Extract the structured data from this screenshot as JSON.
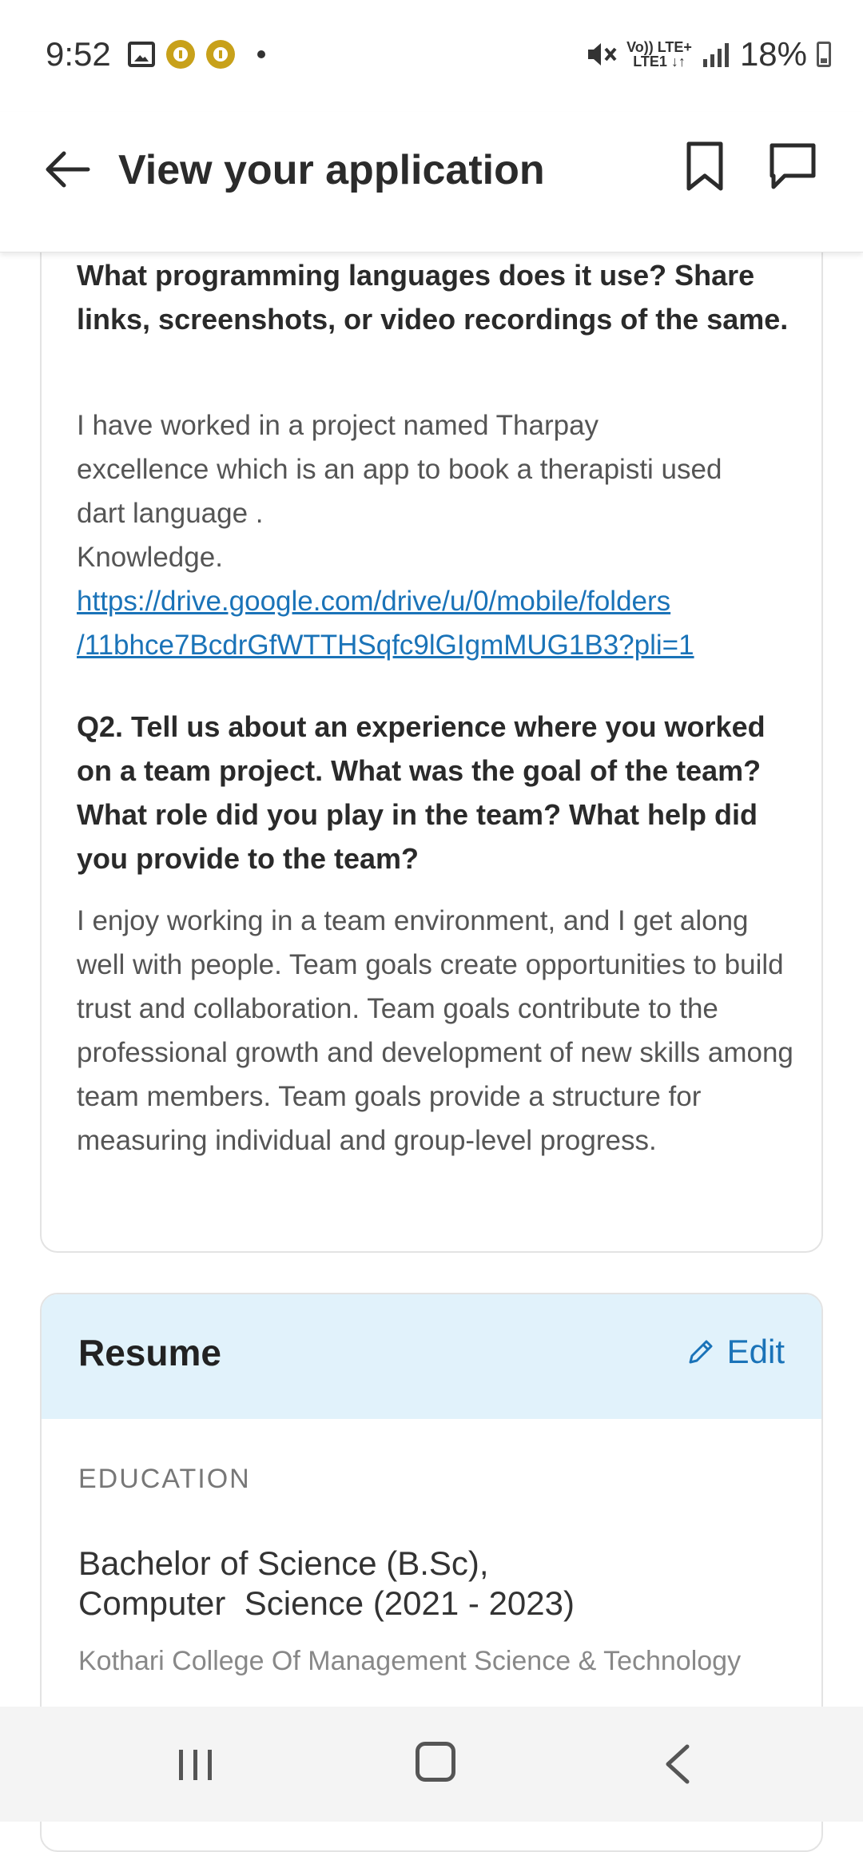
{
  "status_bar": {
    "time": "9:52",
    "lte_top": "Vo)) LTE+",
    "lte_bottom": "LTE1 ↓↑",
    "battery": "18%"
  },
  "app_bar": {
    "title": "View your application"
  },
  "application": {
    "q1_tail": "What programming languages does it use? Share links, screenshots, or video recordings of the same.",
    "a1_lines": [
      "I have worked in a project named Tharpay",
      "excellence which is an app to book a therapisti used",
      "dart language .",
      "Knowledge."
    ],
    "a1_link_line1": "https://drive.google.com/drive/u/0/mobile/folders",
    "a1_link_line2": "/11bhce7BcdrGfWTTHSqfc9lGIgmMUG1B3?pli=1",
    "q2": "Q2. Tell us about an experience where you worked on a team project. What was the goal of the team? What role did you play in the team? What help did you provide to the team?",
    "a2": "I enjoy working in a team environment, and I get along well with people. Team goals create opportunities to build trust and collaboration. Team goals contribute to the professional growth and development of new skills among team members. Team goals provide a structure for measuring individual and group-level progress."
  },
  "resume": {
    "title": "Resume",
    "edit_label": "Edit",
    "education_label": "EDUCATION",
    "degree_line1": "Bachelor of Science (B.Sc),",
    "degree_line2": "Computer  Science (2021 - 2023)",
    "college": "Kothari College Of Management Science & Technology"
  }
}
